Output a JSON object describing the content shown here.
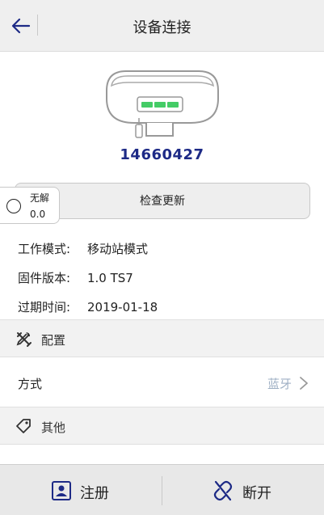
{
  "header": {
    "title": "设备连接",
    "back_icon": "back-arrow-icon"
  },
  "device": {
    "serial": "14660427",
    "led_color": "#44cc66"
  },
  "status": {
    "label": "无解",
    "value": "0.0"
  },
  "update_button": {
    "label": "检查更新"
  },
  "info": [
    {
      "key": "工作模式:",
      "value": "移动站模式"
    },
    {
      "key": "固件版本:",
      "value": "1.0  TS7"
    },
    {
      "key": "过期时间:",
      "value": "2019-01-18"
    }
  ],
  "sections": {
    "config": {
      "label": "配置",
      "icon": "tools-icon"
    },
    "other": {
      "label": "其他",
      "icon": "tag-icon"
    }
  },
  "config_row": {
    "label": "方式",
    "value": "蓝牙"
  },
  "bottom": {
    "register": {
      "label": "注册",
      "icon": "id-card-icon"
    },
    "disconnect": {
      "label": "断开",
      "icon": "broken-link-icon"
    }
  },
  "colors": {
    "accent": "#1d2a86",
    "muted_value": "#9fb0c4"
  }
}
